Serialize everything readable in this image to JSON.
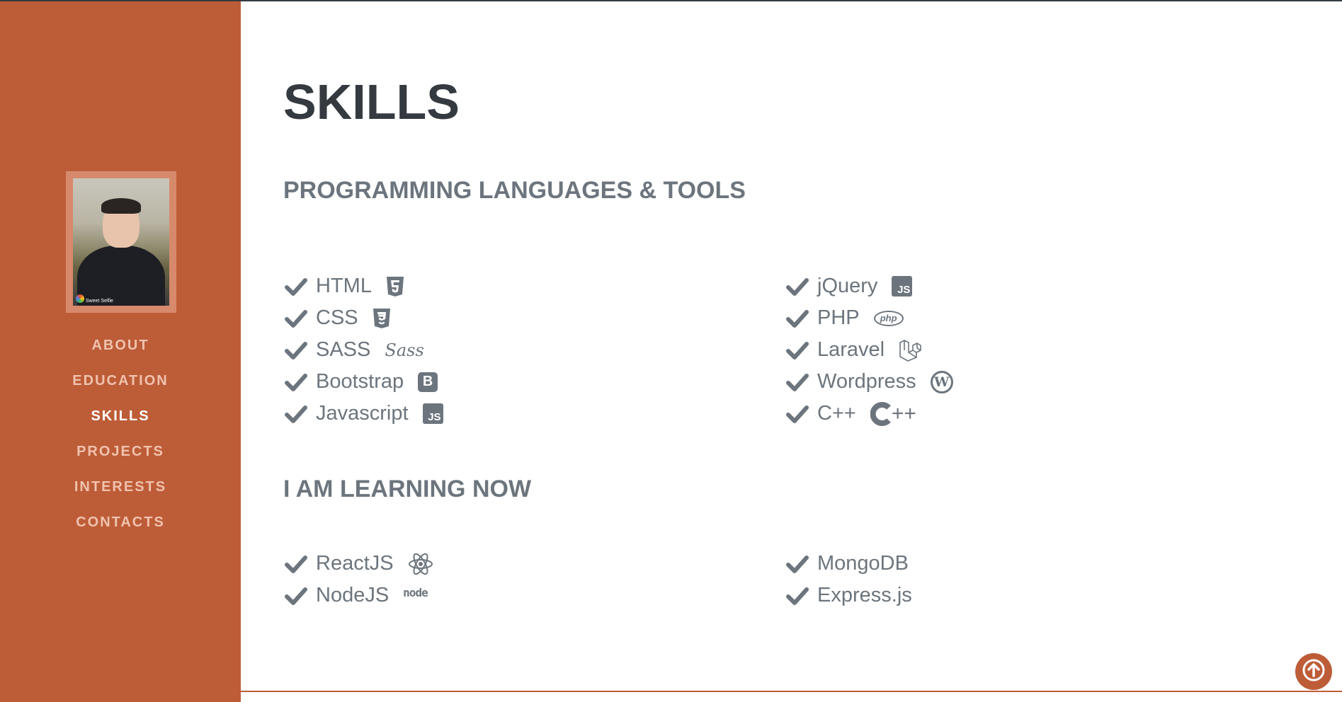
{
  "sidebar": {
    "avatar_badge": "Sweet Selfie",
    "nav": [
      {
        "label": "ABOUT"
      },
      {
        "label": "EDUCATION"
      },
      {
        "label": "SKILLS",
        "active": true
      },
      {
        "label": "PROJECTS"
      },
      {
        "label": "INTERESTS"
      },
      {
        "label": "CONTACTS"
      }
    ]
  },
  "main": {
    "title": "SKILLS",
    "sections": [
      {
        "title": "PROGRAMMING LANGUAGES & TOOLS",
        "left": [
          {
            "label": "HTML",
            "icon": "html5-icon"
          },
          {
            "label": "CSS",
            "icon": "css3-icon"
          },
          {
            "label": "SASS",
            "icon": "sass-icon",
            "icon_text": "Sass"
          },
          {
            "label": "Bootstrap",
            "icon": "bootstrap-icon",
            "icon_text": "B"
          },
          {
            "label": "Javascript",
            "icon": "js-icon",
            "icon_text": "JS"
          }
        ],
        "right": [
          {
            "label": "jQuery",
            "icon": "js-icon",
            "icon_text": "JS"
          },
          {
            "label": "PHP",
            "icon": "php-icon",
            "icon_text": "php"
          },
          {
            "label": "Laravel",
            "icon": "laravel-icon"
          },
          {
            "label": "Wordpress",
            "icon": "wordpress-icon",
            "icon_text": "W"
          },
          {
            "label": "C++",
            "icon": "cplusplus-icon",
            "icon_text": "++"
          }
        ]
      },
      {
        "title": "I AM LEARNING NOW",
        "left": [
          {
            "label": "ReactJS",
            "icon": "react-icon"
          },
          {
            "label": "NodeJS",
            "icon": "nodejs-icon",
            "icon_text": "node"
          }
        ],
        "right": [
          {
            "label": "MongoDB"
          },
          {
            "label": "Express.js"
          }
        ]
      }
    ]
  },
  "colors": {
    "sidebar_bg": "#bd5d38",
    "nav_text": "#f0c2ae",
    "nav_active": "#ffffff",
    "title": "#343a40",
    "muted": "#6c757d"
  }
}
